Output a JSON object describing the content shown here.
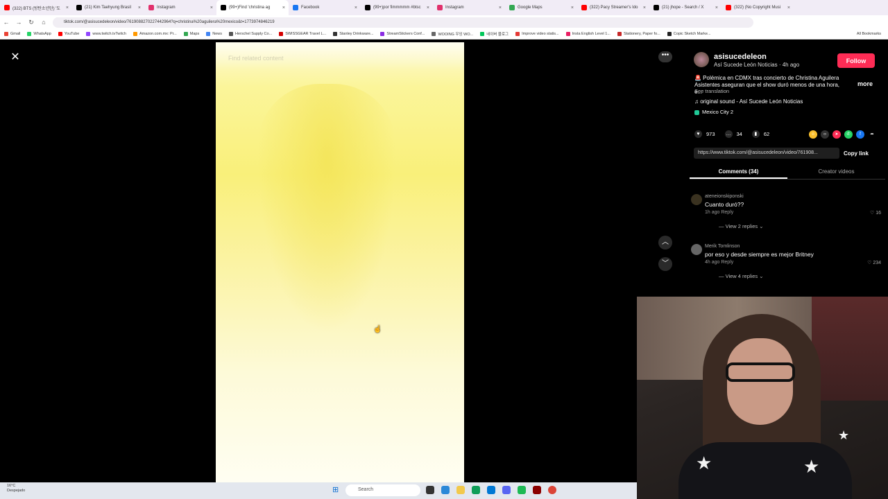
{
  "browser": {
    "tabs": [
      {
        "title": "(322) BTS (방탄소년단) '도",
        "color": "#ff0000"
      },
      {
        "title": "(21) Kim Taehyung Brasil",
        "color": "#000000"
      },
      {
        "title": "Instagram",
        "color": "#e1306c"
      },
      {
        "title": "(99+)Find 'christina ag",
        "color": "#000000",
        "active": true
      },
      {
        "title": "Facebook",
        "color": "#1877f2"
      },
      {
        "title": "(99+)por fimmmmm #btsc",
        "color": "#000000"
      },
      {
        "title": "Instagram",
        "color": "#e1306c"
      },
      {
        "title": "Google Maps",
        "color": "#34a853"
      },
      {
        "title": "(322) Pacy Streamer's Ido",
        "color": "#ff0000"
      },
      {
        "title": "(21) jhope - Search / X",
        "color": "#000000"
      },
      {
        "title": "(322) (No Copyright Musi",
        "color": "#ff0000"
      }
    ],
    "url": "tiktok.com/@asisucedeleon/video/7619088270227442964?q=christina%20aguilera%20mexico&t=1773974846219",
    "bookmarks": [
      {
        "label": "Gmail",
        "color": "#ea4335"
      },
      {
        "label": "WhatsApp",
        "color": "#25d366"
      },
      {
        "label": "YouTube",
        "color": "#ff0000"
      },
      {
        "label": "www.twitch.tvTwitch",
        "color": "#9146ff"
      },
      {
        "label": "Amazon.com.mx: Pr...",
        "color": "#ff9900"
      },
      {
        "label": "Maps",
        "color": "#34a853"
      },
      {
        "label": "News",
        "color": "#4285f4"
      },
      {
        "label": "Herschel Supply Co...",
        "color": "#555555"
      },
      {
        "label": "SWISSGEAR Travel L...",
        "color": "#d40000"
      },
      {
        "label": "Stanley Drinkware...",
        "color": "#333333"
      },
      {
        "label": "StreamStickers Conf...",
        "color": "#8a2be2"
      },
      {
        "label": "WOOING 우잉 WO...",
        "color": "#666666"
      },
      {
        "label": "네이버 블로그",
        "color": "#03c75a"
      },
      {
        "label": "Improve video statis...",
        "color": "#e53935"
      },
      {
        "label": "Insta English Level 1...",
        "color": "#e91e63"
      },
      {
        "label": "Stationery, Paper fo...",
        "color": "#c62828"
      },
      {
        "label": "Copic Sketch Marke...",
        "color": "#222222"
      }
    ],
    "all_bookmarks": "All Bookmarks"
  },
  "video": {
    "search_placeholder": "Find related content"
  },
  "post": {
    "username": "asisucedeleon",
    "subline": "Así Sucede León Noticias · 4h ago",
    "follow_label": "Follow",
    "description": "🚨 Polémica en CDMX tras concierto de Christina Aguilera Asistentes aseguran que el show duró menos de una hora, e...",
    "more_label": "more",
    "translate_label": "See translation",
    "sound": "♫  original sound - Así Sucede León Noticias",
    "location": "Mexico City  2",
    "likes": "973",
    "comments": "34",
    "saves": "62",
    "link": "https://www.tiktok.com/@asisucedeleon/video/761908...",
    "copy_link": "Copy link",
    "tab_comments": "Comments (34)",
    "tab_creator": "Creator videos"
  },
  "comments": [
    {
      "name": "ateneionskiponski",
      "text": "Cuanto duró??",
      "meta": "1h ago   Reply",
      "likes": "16",
      "replies": "View 2 replies"
    },
    {
      "name": "Merik Tomlinson",
      "text": "por eso y desde siempre es mejor Britney",
      "meta": "4h ago   Reply",
      "likes": "234",
      "replies": "View 4 replies"
    }
  ],
  "taskbar": {
    "weather_temp": "16°C",
    "weather_desc": "Despejado",
    "search_label": "Search"
  }
}
